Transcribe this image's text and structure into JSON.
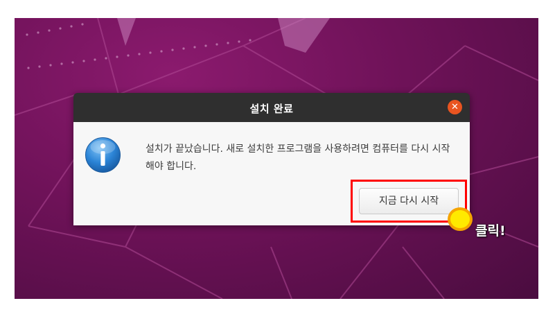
{
  "dialog": {
    "title": "설치 완료",
    "close_icon": "close-icon",
    "info_icon": "information-icon",
    "message": "설치가 끝났습니다. 새로 설치한 프로그램을 사용하려면 컴퓨터를 다시 시작해야 합니다.",
    "restart_button_label": "지금 다시 시작"
  },
  "annotation": {
    "click_label": "클릭!",
    "highlight_color": "#ff0000",
    "cursor_color": "#ffea00"
  },
  "colors": {
    "desktop_background": "#6e1258",
    "titlebar": "#2f2f2f",
    "close_button": "#e95420"
  }
}
